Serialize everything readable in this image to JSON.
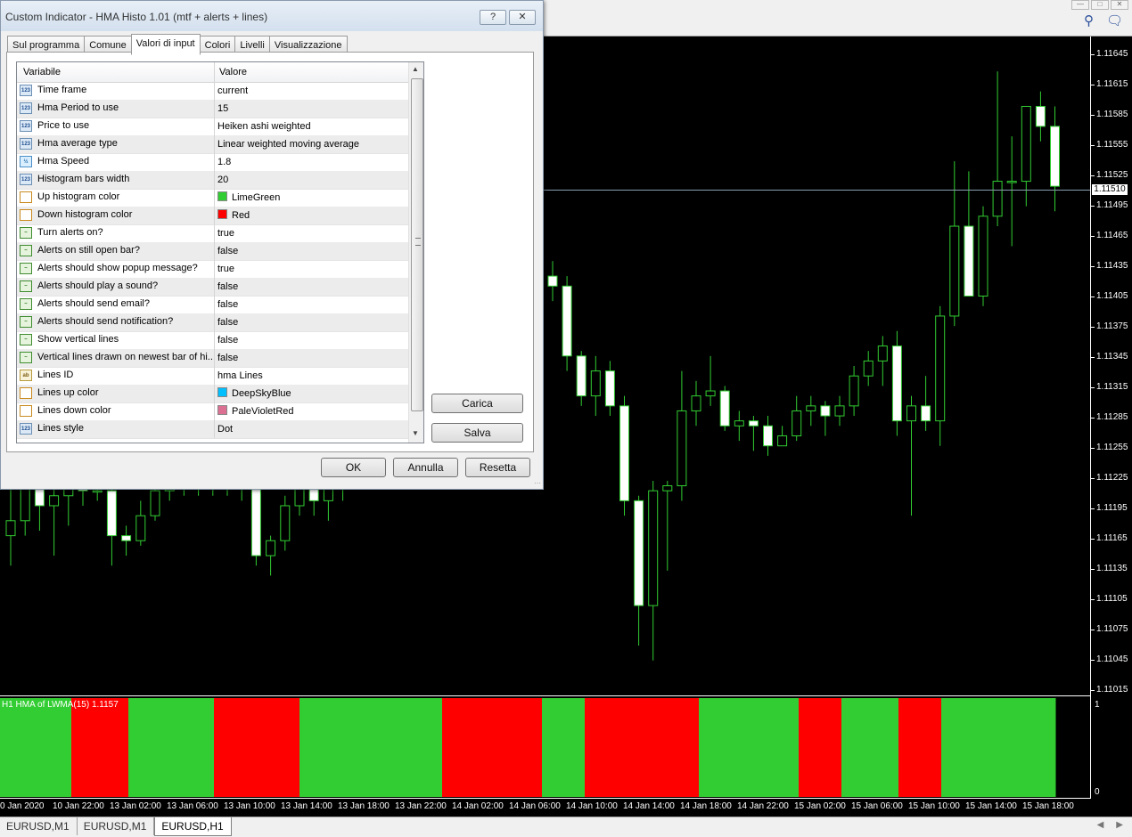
{
  "dialog": {
    "title": "Custom Indicator - HMA Histo 1.01 (mtf + alerts + lines)",
    "help_label": "?",
    "close_label": "✕",
    "tabs": [
      {
        "label": "Sul programma"
      },
      {
        "label": "Comune"
      },
      {
        "label": "Valori di input"
      },
      {
        "label": "Colori"
      },
      {
        "label": "Livelli"
      },
      {
        "label": "Visualizzazione"
      }
    ],
    "active_tab": "Valori di input",
    "grid": {
      "col_variable": "Variabile",
      "col_value": "Valore",
      "rows": [
        {
          "name": "Time frame",
          "value": "current",
          "type": "int"
        },
        {
          "name": "Hma Period to use",
          "value": "15",
          "type": "int"
        },
        {
          "name": "Price to use",
          "value": "Heiken ashi weighted",
          "type": "int"
        },
        {
          "name": "Hma average type",
          "value": "Linear weighted moving average",
          "type": "int"
        },
        {
          "name": "Hma Speed",
          "value": "1.8",
          "type": "double"
        },
        {
          "name": "Histogram bars width",
          "value": "20",
          "type": "int"
        },
        {
          "name": "Up histogram color",
          "value": "LimeGreen",
          "type": "color",
          "swatch": "#32cd32"
        },
        {
          "name": "Down histogram color",
          "value": "Red",
          "type": "color",
          "swatch": "#ff0000"
        },
        {
          "name": "Turn alerts on?",
          "value": "true",
          "type": "bool"
        },
        {
          "name": "Alerts on still open bar?",
          "value": "false",
          "type": "bool"
        },
        {
          "name": "Alerts should show popup message?",
          "value": "true",
          "type": "bool"
        },
        {
          "name": "Alerts should play a sound?",
          "value": "false",
          "type": "bool"
        },
        {
          "name": "Alerts should send email?",
          "value": "false",
          "type": "bool"
        },
        {
          "name": "Alerts should send notification?",
          "value": "false",
          "type": "bool"
        },
        {
          "name": "Show vertical lines",
          "value": "false",
          "type": "bool"
        },
        {
          "name": "Vertical lines drawn on newest bar of hi...",
          "value": "false",
          "type": "bool"
        },
        {
          "name": "Lines ID",
          "value": "hma Lines",
          "type": "string"
        },
        {
          "name": "Lines up color",
          "value": "DeepSkyBlue",
          "type": "color",
          "swatch": "#00bfff"
        },
        {
          "name": "Lines down color",
          "value": "PaleVioletRed",
          "type": "color",
          "swatch": "#db7093"
        },
        {
          "name": "Lines style",
          "value": "Dot",
          "type": "int"
        }
      ]
    },
    "load_button": "Carica",
    "save_button": "Salva",
    "ok_button": "OK",
    "cancel_button": "Annulla",
    "reset_button": "Resetta"
  },
  "chart": {
    "price_labels": [
      "1.11645",
      "1.11615",
      "1.11585",
      "1.11555",
      "1.11525",
      "1.11495",
      "1.11465",
      "1.11435",
      "1.11405",
      "1.11375",
      "1.11345",
      "1.11315",
      "1.11285",
      "1.11255",
      "1.11225",
      "1.11195",
      "1.11165",
      "1.11135",
      "1.11105",
      "1.11075",
      "1.11045",
      "1.11015"
    ],
    "current_price": "1.11510",
    "indicator_label": "H1 HMA of LWMA(15) 1.1157",
    "indicator_axis_top": "1",
    "indicator_axis_bottom": "0",
    "time_labels": [
      "0 Jan 2020",
      "10 Jan 22:00",
      "13 Jan 02:00",
      "13 Jan 06:00",
      "13 Jan 10:00",
      "13 Jan 14:00",
      "13 Jan 18:00",
      "13 Jan 22:00",
      "14 Jan 02:00",
      "14 Jan 06:00",
      "14 Jan 10:00",
      "14 Jan 14:00",
      "14 Jan 18:00",
      "14 Jan 22:00",
      "15 Jan 02:00",
      "15 Jan 06:00",
      "15 Jan 10:00",
      "15 Jan 14:00",
      "15 Jan 18:00"
    ],
    "up_color": "#32cd32",
    "down_color": "#ff0000",
    "histogram": [
      "up",
      "up",
      "up",
      "up",
      "up",
      "down",
      "down",
      "down",
      "down",
      "up",
      "up",
      "up",
      "up",
      "up",
      "up",
      "down",
      "down",
      "down",
      "down",
      "down",
      "down",
      "up",
      "up",
      "up",
      "up",
      "up",
      "up",
      "up",
      "up",
      "up",
      "up",
      "down",
      "down",
      "down",
      "down",
      "down",
      "down",
      "down",
      "up",
      "up",
      "up",
      "down",
      "down",
      "down",
      "down",
      "down",
      "down",
      "down",
      "down",
      "up",
      "up",
      "up",
      "up",
      "up",
      "up",
      "up",
      "down",
      "down",
      "down",
      "up",
      "up",
      "up",
      "up",
      "down",
      "down",
      "down",
      "up",
      "up",
      "up",
      "up",
      "up",
      "up",
      "up",
      "up"
    ],
    "candles": [
      {
        "o": 1.1116,
        "h": 1.11235,
        "l": 1.1113,
        "c": 1.11175
      },
      {
        "o": 1.11175,
        "h": 1.1124,
        "l": 1.1116,
        "c": 1.1123
      },
      {
        "o": 1.1123,
        "h": 1.11245,
        "l": 1.11165,
        "c": 1.1119
      },
      {
        "o": 1.1119,
        "h": 1.1123,
        "l": 1.1114,
        "c": 1.112
      },
      {
        "o": 1.112,
        "h": 1.11225,
        "l": 1.1117,
        "c": 1.1121
      },
      {
        "o": 1.1121,
        "h": 1.11225,
        "l": 1.1119,
        "c": 1.11205
      },
      {
        "o": 1.11205,
        "h": 1.11215,
        "l": 1.11195,
        "c": 1.11205
      },
      {
        "o": 1.11205,
        "h": 1.1121,
        "l": 1.1113,
        "c": 1.1116
      },
      {
        "o": 1.1116,
        "h": 1.1117,
        "l": 1.1114,
        "c": 1.11155
      },
      {
        "o": 1.11155,
        "h": 1.11195,
        "l": 1.1115,
        "c": 1.1118
      },
      {
        "o": 1.1118,
        "h": 1.1122,
        "l": 1.11175,
        "c": 1.11205
      },
      {
        "o": 1.11205,
        "h": 1.11235,
        "l": 1.11195,
        "c": 1.1122
      },
      {
        "o": 1.1122,
        "h": 1.1124,
        "l": 1.112,
        "c": 1.11225
      },
      {
        "o": 1.11225,
        "h": 1.11235,
        "l": 1.112,
        "c": 1.1122
      },
      {
        "o": 1.1122,
        "h": 1.1124,
        "l": 1.112,
        "c": 1.11225
      },
      {
        "o": 1.11225,
        "h": 1.1124,
        "l": 1.112,
        "c": 1.11225
      },
      {
        "o": 1.11225,
        "h": 1.1124,
        "l": 1.11195,
        "c": 1.11215
      },
      {
        "o": 1.11215,
        "h": 1.1124,
        "l": 1.1113,
        "c": 1.1114
      },
      {
        "o": 1.1114,
        "h": 1.1116,
        "l": 1.1112,
        "c": 1.11155
      },
      {
        "o": 1.11155,
        "h": 1.112,
        "l": 1.11145,
        "c": 1.1119
      },
      {
        "o": 1.1119,
        "h": 1.11235,
        "l": 1.1118,
        "c": 1.1122
      },
      {
        "o": 1.1122,
        "h": 1.1124,
        "l": 1.1118,
        "c": 1.11195
      },
      {
        "o": 1.11195,
        "h": 1.11235,
        "l": 1.11175,
        "c": 1.11225
      },
      {
        "o": 1.11225,
        "h": 1.1124,
        "l": 1.11195,
        "c": 1.11225
      },
      {
        "o": 1.1142,
        "h": 1.11435,
        "l": 1.11395,
        "c": 1.1141
      },
      {
        "o": 1.1141,
        "h": 1.1142,
        "l": 1.11325,
        "c": 1.1134
      },
      {
        "o": 1.1134,
        "h": 1.11345,
        "l": 1.1129,
        "c": 1.113
      },
      {
        "o": 1.113,
        "h": 1.1134,
        "l": 1.1128,
        "c": 1.11325
      },
      {
        "o": 1.11325,
        "h": 1.11335,
        "l": 1.1128,
        "c": 1.1129
      },
      {
        "o": 1.1129,
        "h": 1.113,
        "l": 1.1118,
        "c": 1.11195
      },
      {
        "o": 1.11195,
        "h": 1.112,
        "l": 1.1105,
        "c": 1.1109
      },
      {
        "o": 1.1109,
        "h": 1.11215,
        "l": 1.11035,
        "c": 1.11205
      },
      {
        "o": 1.11205,
        "h": 1.11215,
        "l": 1.11125,
        "c": 1.1121
      },
      {
        "o": 1.1121,
        "h": 1.11325,
        "l": 1.11195,
        "c": 1.11285
      },
      {
        "o": 1.11285,
        "h": 1.11315,
        "l": 1.1127,
        "c": 1.113
      },
      {
        "o": 1.113,
        "h": 1.1134,
        "l": 1.1129,
        "c": 1.11305
      },
      {
        "o": 1.11305,
        "h": 1.1131,
        "l": 1.11265,
        "c": 1.1127
      },
      {
        "o": 1.1127,
        "h": 1.11285,
        "l": 1.11255,
        "c": 1.11275
      },
      {
        "o": 1.11275,
        "h": 1.1128,
        "l": 1.11245,
        "c": 1.1127
      },
      {
        "o": 1.1127,
        "h": 1.1128,
        "l": 1.1124,
        "c": 1.1125
      },
      {
        "o": 1.1125,
        "h": 1.1127,
        "l": 1.1125,
        "c": 1.1126
      },
      {
        "o": 1.1126,
        "h": 1.113,
        "l": 1.11255,
        "c": 1.11285
      },
      {
        "o": 1.11285,
        "h": 1.113,
        "l": 1.1127,
        "c": 1.1129
      },
      {
        "o": 1.1129,
        "h": 1.11295,
        "l": 1.1126,
        "c": 1.1128
      },
      {
        "o": 1.1128,
        "h": 1.113,
        "l": 1.1127,
        "c": 1.1129
      },
      {
        "o": 1.1129,
        "h": 1.1133,
        "l": 1.1128,
        "c": 1.1132
      },
      {
        "o": 1.1132,
        "h": 1.11345,
        "l": 1.1131,
        "c": 1.11335
      },
      {
        "o": 1.11335,
        "h": 1.1136,
        "l": 1.1131,
        "c": 1.1135
      },
      {
        "o": 1.1135,
        "h": 1.11365,
        "l": 1.1126,
        "c": 1.11275
      },
      {
        "o": 1.11275,
        "h": 1.113,
        "l": 1.1118,
        "c": 1.1129
      },
      {
        "o": 1.1129,
        "h": 1.1132,
        "l": 1.11265,
        "c": 1.11275
      },
      {
        "o": 1.11275,
        "h": 1.1139,
        "l": 1.1125,
        "c": 1.1138
      },
      {
        "o": 1.1138,
        "h": 1.11535,
        "l": 1.1137,
        "c": 1.1147
      },
      {
        "o": 1.1147,
        "h": 1.11525,
        "l": 1.114,
        "c": 1.114
      },
      {
        "o": 1.114,
        "h": 1.1149,
        "l": 1.1139,
        "c": 1.1148
      },
      {
        "o": 1.1148,
        "h": 1.11625,
        "l": 1.1147,
        "c": 1.11515
      },
      {
        "o": 1.11515,
        "h": 1.1156,
        "l": 1.1145,
        "c": 1.11515
      },
      {
        "o": 1.11515,
        "h": 1.11585,
        "l": 1.1149,
        "c": 1.1159
      },
      {
        "o": 1.1159,
        "h": 1.11605,
        "l": 1.11555,
        "c": 1.1157
      },
      {
        "o": 1.1157,
        "h": 1.1159,
        "l": 1.11485,
        "c": 1.1151
      }
    ]
  },
  "bottom_tabs": [
    {
      "label": "EURUSD,M1"
    },
    {
      "label": "EURUSD,M1"
    },
    {
      "label": "EURUSD,H1"
    }
  ]
}
